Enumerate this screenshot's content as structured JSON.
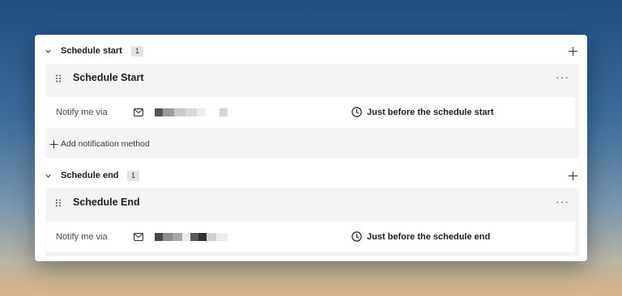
{
  "sections": [
    {
      "title": "Schedule start",
      "count": "1",
      "group_title": "Schedule Start",
      "row": {
        "label": "Notify me via",
        "timing": "Just before the schedule start"
      },
      "add_method_label": "Add notification method"
    },
    {
      "title": "Schedule end",
      "count": "1",
      "group_title": "Schedule End",
      "row": {
        "label": "Notify me via",
        "timing": "Just before the schedule end"
      }
    }
  ],
  "icons": {
    "collapse": "chevron-down-icon",
    "add": "plus-icon",
    "drag": "drag-handle-icon",
    "more": "more-options-icon",
    "email": "mail-icon",
    "time": "clock-icon"
  },
  "colors": {
    "panel_bg": "#ffffff",
    "group_bg": "#f4f4f4",
    "text_primary": "#1e1e1e",
    "text_secondary": "#4a4a4a"
  },
  "more_glyph": "···"
}
